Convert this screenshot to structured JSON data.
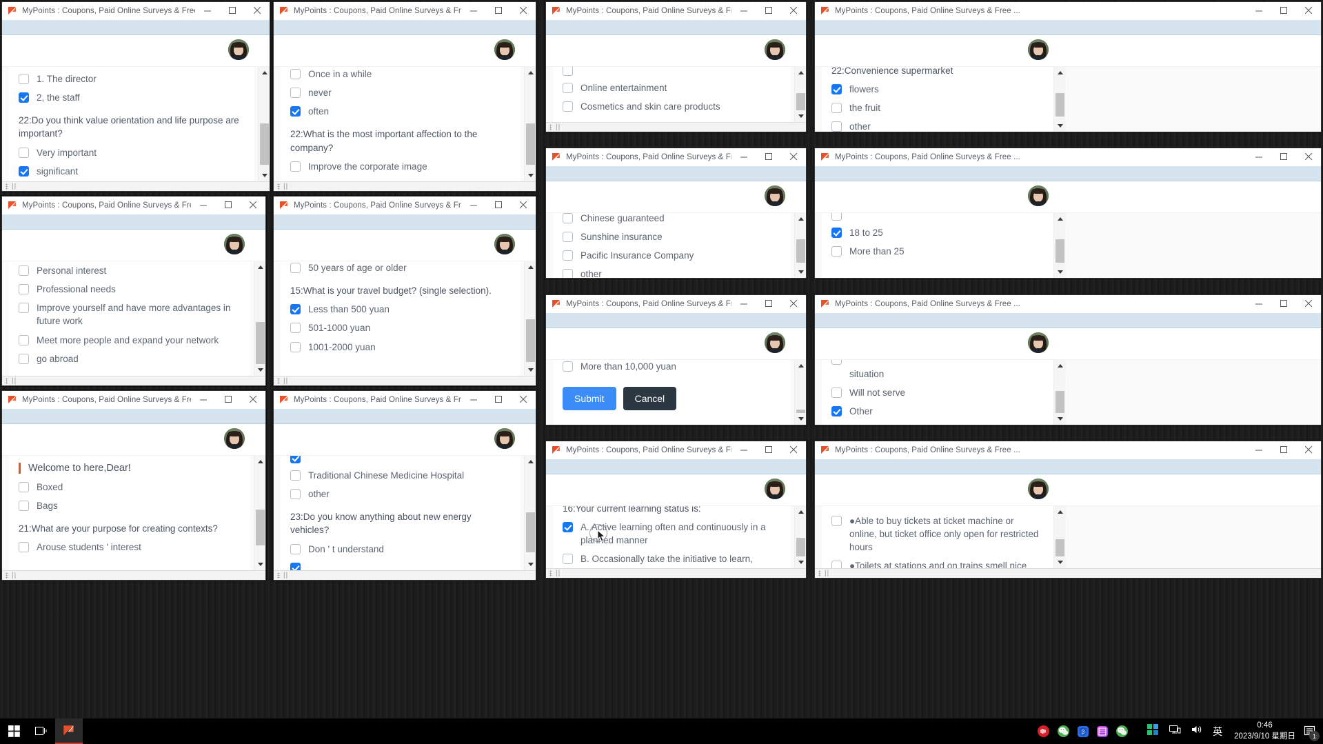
{
  "window_title": "MyPoints : Coupons, Paid Online Surveys & Free ...",
  "controls": {
    "minimize": "minimize-icon",
    "maximize": "maximize-icon",
    "close": "close-icon"
  },
  "buttons": {
    "submit": "Submit",
    "cancel": "Cancel"
  },
  "welcome": "Welcome to here,Dear!",
  "windows": [
    {
      "id": "w1",
      "items": [
        {
          "type": "option",
          "text": "1. The director",
          "checked": false
        },
        {
          "type": "option",
          "text": "2, the staff",
          "checked": true
        },
        {
          "type": "question",
          "text": "22:Do you think value orientation and life purpose are important?"
        },
        {
          "type": "option",
          "text": "Very important",
          "checked": false
        },
        {
          "type": "option",
          "text": "significant",
          "checked": true
        }
      ]
    },
    {
      "id": "w2",
      "items": [
        {
          "type": "option",
          "text": "Once in a while",
          "checked": false
        },
        {
          "type": "option",
          "text": "never",
          "checked": false
        },
        {
          "type": "option",
          "text": "often",
          "checked": true
        },
        {
          "type": "question",
          "text": "22:What is the most important affection to the company?"
        },
        {
          "type": "option",
          "text": "Improve the corporate image",
          "checked": false
        }
      ]
    },
    {
      "id": "w3",
      "items": [
        {
          "type": "option",
          "text": "",
          "checked": false
        },
        {
          "type": "option",
          "text": "Online entertainment",
          "checked": false
        },
        {
          "type": "option",
          "text": "Cosmetics and skin care products",
          "checked": false
        }
      ]
    },
    {
      "id": "w4",
      "items": [
        {
          "type": "question",
          "text": "22:Convenience supermarket"
        },
        {
          "type": "option",
          "text": "flowers",
          "checked": true
        },
        {
          "type": "option",
          "text": "the fruit",
          "checked": false
        },
        {
          "type": "option",
          "text": "other",
          "checked": false
        }
      ]
    },
    {
      "id": "w5",
      "items": [
        {
          "type": "option",
          "text": "Personal interest",
          "checked": false
        },
        {
          "type": "option",
          "text": "Professional needs",
          "checked": false
        },
        {
          "type": "option",
          "text": "Improve yourself and have more advantages in future work",
          "checked": false
        },
        {
          "type": "option",
          "text": "Meet more people and expand your network",
          "checked": false
        },
        {
          "type": "option",
          "text": "go abroad",
          "checked": false
        }
      ]
    },
    {
      "id": "w6",
      "items": [
        {
          "type": "option",
          "text": "50 years of age or older",
          "checked": false
        },
        {
          "type": "question",
          "text": "15:What is your travel budget? (single selection)."
        },
        {
          "type": "option",
          "text": "Less than 500 yuan",
          "checked": true
        },
        {
          "type": "option",
          "text": "501-1000 yuan",
          "checked": false
        },
        {
          "type": "option",
          "text": "1001-2000 yuan",
          "checked": false
        }
      ]
    },
    {
      "id": "w7",
      "items": [
        {
          "type": "option",
          "text": "Chinese guaranteed",
          "checked": false
        },
        {
          "type": "option",
          "text": "Sunshine insurance",
          "checked": false
        },
        {
          "type": "option",
          "text": "Pacific Insurance Company",
          "checked": false
        },
        {
          "type": "option",
          "text": "other",
          "checked": false
        }
      ]
    },
    {
      "id": "w8",
      "items": [
        {
          "type": "option",
          "text": "",
          "checked": false
        },
        {
          "type": "option",
          "text": "18 to 25",
          "checked": true
        },
        {
          "type": "option",
          "text": "More than 25",
          "checked": false
        }
      ]
    },
    {
      "id": "w9",
      "items": [
        {
          "type": "option",
          "text": "More than 10,000 yuan",
          "checked": false
        },
        {
          "type": "buttons"
        }
      ]
    },
    {
      "id": "w10",
      "items": [
        {
          "type": "option",
          "text": "",
          "checked": false
        },
        {
          "type": "continuation",
          "text": "situation"
        },
        {
          "type": "option",
          "text": "Will not serve",
          "checked": false
        },
        {
          "type": "option",
          "text": "Other",
          "checked": true
        }
      ]
    },
    {
      "id": "w11",
      "items": [
        {
          "type": "welcome",
          "text": "Welcome to here,Dear!"
        },
        {
          "type": "option",
          "text": "Boxed",
          "checked": false
        },
        {
          "type": "option",
          "text": "Bags",
          "checked": false
        },
        {
          "type": "question",
          "text": "21:What are your purpose for creating contexts?"
        },
        {
          "type": "option",
          "text": "Arouse students ' interest",
          "checked": false
        }
      ]
    },
    {
      "id": "w12",
      "items": [
        {
          "type": "option",
          "text": "",
          "checked": true
        },
        {
          "type": "option",
          "text": "Traditional Chinese Medicine Hospital",
          "checked": false
        },
        {
          "type": "option",
          "text": "other",
          "checked": false
        },
        {
          "type": "question",
          "text": "23:Do you know anything about new energy vehicles?"
        },
        {
          "type": "option",
          "text": "Don ' t understand",
          "checked": false
        },
        {
          "type": "option",
          "text": "",
          "checked": true
        }
      ]
    },
    {
      "id": "w13",
      "items": [
        {
          "type": "question",
          "text": "16:Your current learning status is:"
        },
        {
          "type": "option",
          "text": "A. Active learning often and continuously in a planned manner",
          "checked": true
        },
        {
          "type": "option",
          "text": "B. Occasionally take the initiative to learn,",
          "checked": false
        }
      ]
    },
    {
      "id": "w14",
      "items": [
        {
          "type": "option",
          "text": "●Able to buy tickets at ticket machine or online, but ticket office only open for restricted hours",
          "checked": false
        },
        {
          "type": "option",
          "text": "●Toilets at stations and on trains smell nice",
          "checked": false
        }
      ]
    }
  ],
  "taskbar": {
    "start": "windows-start-icon",
    "task_view": "task-view-icon",
    "apps": [
      "firefox-browser-icon"
    ],
    "tray": [
      "netease-music-icon",
      "wechat-icon",
      "driver-booster-icon",
      "screen-capture-icon",
      "wechat-work-icon"
    ],
    "system": [
      "qq-icon",
      "network-icon",
      "volume-icon"
    ],
    "ime_label": "英",
    "time": "0:46",
    "date": "2023/9/10 星期日",
    "notification_count": "1"
  }
}
